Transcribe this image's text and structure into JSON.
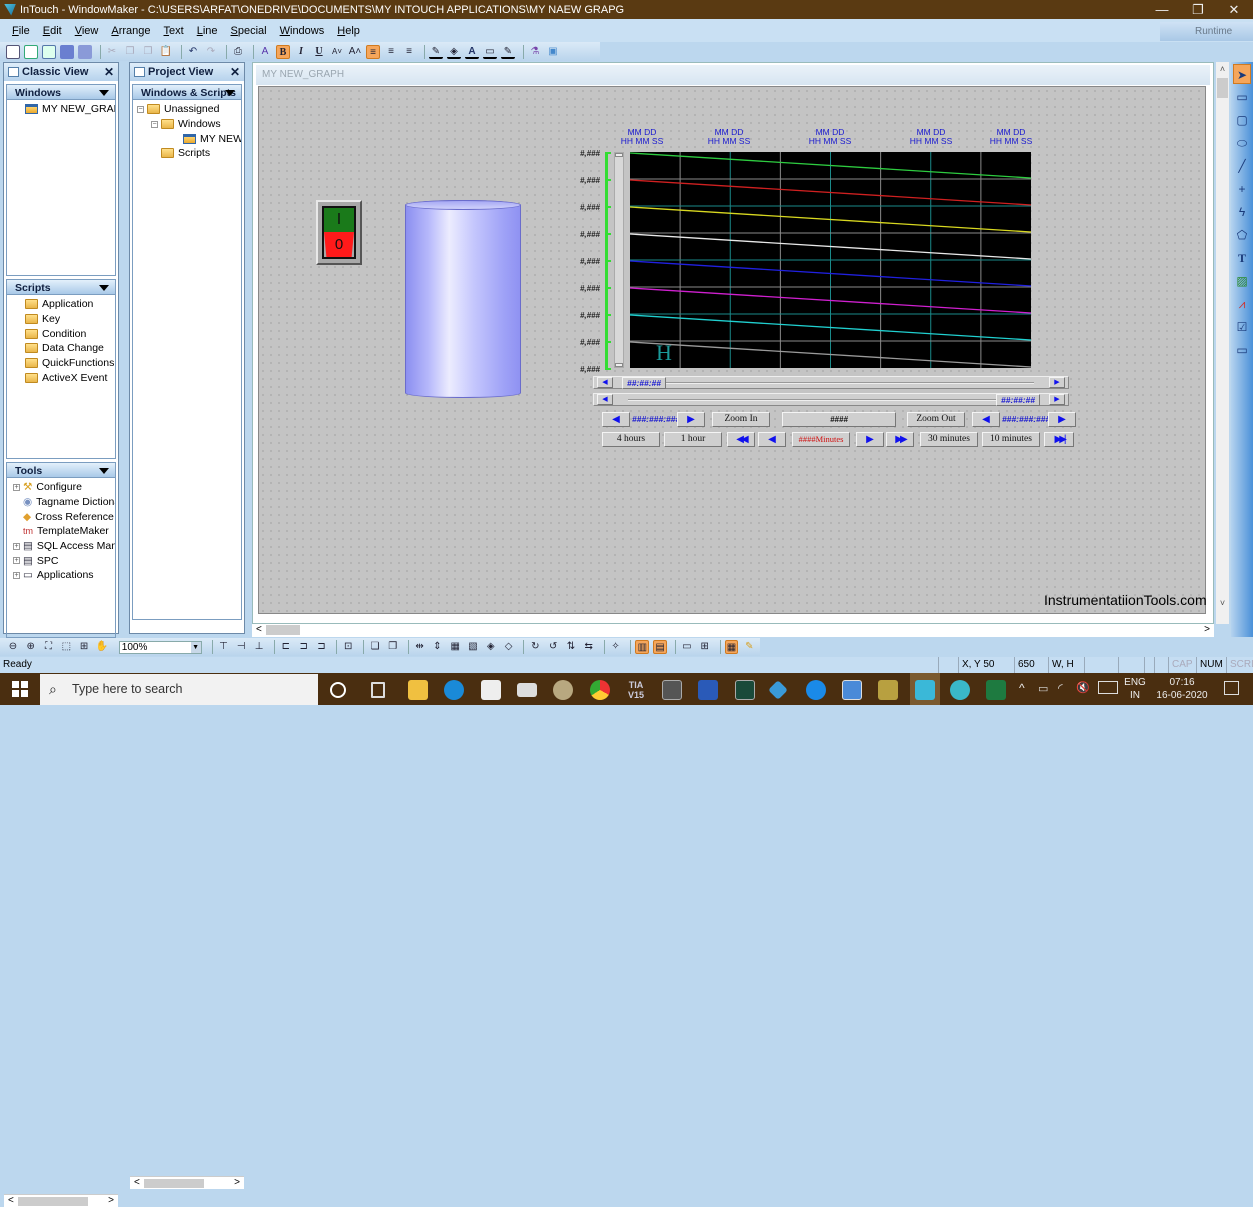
{
  "window": {
    "title": "InTouch - WindowMaker - C:\\USERS\\ARFAT\\ONEDRIVE\\DOCUMENTS\\MY INTOUCH APPLICATIONS\\MY NAEW GRAPG",
    "minimize": "—",
    "maximize": "❐",
    "close": "✕"
  },
  "menu": [
    "File",
    "Edit",
    "View",
    "Arrange",
    "Text",
    "Line",
    "Special",
    "Windows",
    "Help"
  ],
  "runtime_label": "Runtime",
  "toolbar": {
    "bold": "B",
    "italic": "I",
    "underline": "U"
  },
  "classic_view": {
    "title": "Classic View",
    "close": "✕",
    "windows_header": "Windows",
    "windows": [
      "MY NEW_GRAPH"
    ],
    "scripts_header": "Scripts",
    "scripts": [
      "Application",
      "Key",
      "Condition",
      "Data Change",
      "QuickFunctions",
      "ActiveX Event"
    ],
    "tools_header": "Tools",
    "tools": [
      "Configure",
      "Tagname Dictionary",
      "Cross Reference",
      "TemplateMaker",
      "SQL Access Manager",
      "SPC",
      "Applications"
    ]
  },
  "project_view": {
    "title": "Project View",
    "close": "✕",
    "header": "Windows & Scripts",
    "tree": {
      "root": "Unassigned",
      "windows_folder": "Windows",
      "window_item": "MY NEW_GRAPH",
      "scripts_folder": "Scripts"
    }
  },
  "editor": {
    "window_title": "MY NEW_GRAPH",
    "switch": {
      "on_label": "I",
      "off_label": "0"
    },
    "trend": {
      "time_labels": [
        {
          "date": "MM DD",
          "time": "HH MM SS"
        },
        {
          "date": "MM DD",
          "time": "HH MM SS"
        },
        {
          "date": "MM DD",
          "time": "HH MM SS"
        },
        {
          "date": "MM DD",
          "time": "HH MM SS"
        },
        {
          "date": "MM DD",
          "time": "HH MM SS"
        }
      ],
      "y_labels": [
        "#,###",
        "#,###",
        "#,###",
        "#,###",
        "#,###",
        "#,###",
        "#,###",
        "#,###",
        "#,###"
      ],
      "pen_colors": [
        "#2ecc40",
        "#d02020",
        "#d8d820",
        "#e8e8e8",
        "#2020e0",
        "#d020d0",
        "#20d0d0",
        "#9a9a9a"
      ],
      "grid_colors": {
        "major": "#8a8a8a",
        "minor": "#1a8a8a"
      },
      "marker": "H",
      "scroll1_value": "##:##:##",
      "scroll2_value": "##:##:##",
      "controls": {
        "left_time": "###:###:###",
        "zoom_in": "Zoom In",
        "center_value": "####",
        "zoom_out": "Zoom Out",
        "right_time": "###:###:###",
        "span_4h": "4 hours",
        "span_1h": "1 hour",
        "mid_field": "####Minutes",
        "span_30m": "30 minutes",
        "span_10m": "10 minutes"
      }
    },
    "watermark": "InstrumentatiionTools.com"
  },
  "zoom_level": "100%",
  "status": {
    "text": "Ready",
    "xy_label": "X, Y",
    "x": "50",
    "y": "650",
    "wh_label": "W, H",
    "cap": "CAP",
    "num": "NUM",
    "scrl": "SCRL"
  },
  "taskbar": {
    "search_placeholder": "Type here to search",
    "lang": "ENG",
    "region": "IN",
    "time": "07:16",
    "date": "16-06-2020"
  }
}
